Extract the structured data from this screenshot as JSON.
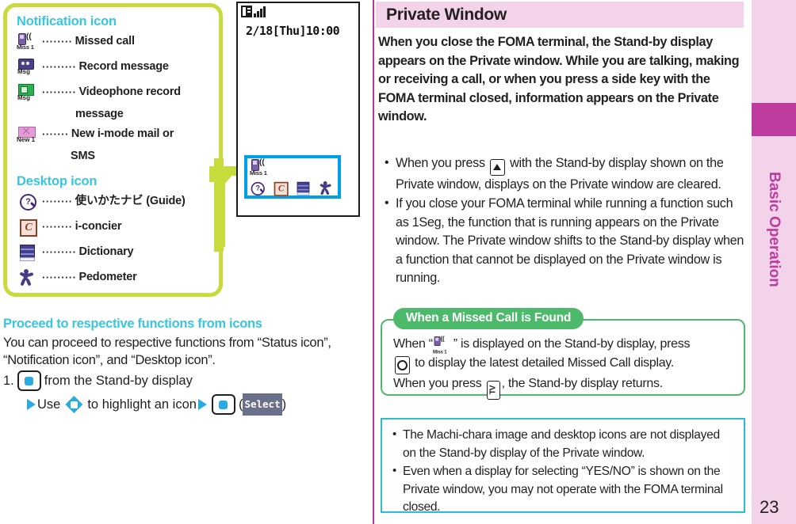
{
  "left": {
    "legend": {
      "notification_heading": "Notification icon",
      "desktop_heading": "Desktop icon",
      "notification_items": [
        {
          "icon": "missed-call-icon",
          "caption": "Miss 1",
          "dots": "········",
          "label": "Missed call",
          "label_cont": ""
        },
        {
          "icon": "record-message-icon",
          "caption": "Msg",
          "dots": "·········",
          "label": "Record message",
          "label_cont": ""
        },
        {
          "icon": "videophone-record-icon",
          "caption": "Msg",
          "dots": "·········",
          "label": "Videophone record",
          "label_cont": "message"
        },
        {
          "icon": "new-mail-icon",
          "caption": "New 1",
          "dots": "·······",
          "label": "New i-mode mail or",
          "label_cont": "SMS"
        }
      ],
      "desktop_items": [
        {
          "icon": "guide-icon",
          "dots": "········",
          "label": "使いかたナビ (Guide)"
        },
        {
          "icon": "i-concier-icon",
          "dots": "········",
          "label": "i-concier"
        },
        {
          "icon": "dictionary-icon",
          "dots": "·········",
          "label": "Dictionary"
        },
        {
          "icon": "pedometer-icon",
          "dots": "·········",
          "label": "Pedometer"
        }
      ]
    },
    "phone": {
      "datetime": "2/18[Thu]10:00",
      "missed_caption": "Miss 1",
      "dock_icons": [
        "guide-icon",
        "i-concier-icon",
        "dictionary-icon",
        "pedometer-icon"
      ]
    },
    "proceed": {
      "heading": "Proceed to respective functions from icons",
      "body": "You can proceed to respective functions from “Status icon”, “Notification icon”, and “Desktop icon”.",
      "step_number": "1.",
      "step_text": "from the Stand-by display",
      "step2_use": "Use",
      "step2_text": "to highlight an icon",
      "step2_open": "(",
      "step2_softkey": "Select",
      "step2_close": ")"
    }
  },
  "right": {
    "title": "Private Window",
    "intro": "When you close the FOMA terminal, the Stand-by display appears on the Private window. While you are talking, making or receiving a call, or when you press a side key with the FOMA terminal closed, information appears on the Private window.",
    "bullets": [
      {
        "pre": "When you press",
        "post": "with the Stand-by display shown on the Private window, displays on the Private window are cleared."
      },
      {
        "pre": "",
        "post": "If you close your FOMA terminal while running a function such as 1Seg, the function that is running appears on the Private window. The Private window shifts to the Stand-by display when a function that cannot be displayed on the Private window is running."
      }
    ],
    "callout": {
      "tab_label": "When a Missed Call is Found",
      "line1_pre": "When “",
      "line1_post": "” is displayed on the Stand-by display, press",
      "line2": "to display the latest detailed Missed Call display.",
      "line3_pre": "When you press",
      "line3_post": ", the Stand-by display returns.",
      "missed_caption": "Miss 1"
    },
    "notes": [
      "The Machi-chara image and desktop icons are not displayed on the Stand-by display of the Private window.",
      "Even when a display for selecting “YES/NO” is shown on the Private window, you may not operate with the FOMA terminal closed."
    ]
  },
  "tab": {
    "label": "Basic Operation",
    "page_number": "23"
  },
  "colors": {
    "legend_border": "#c7dc3c",
    "heading_cyan": "#38c6e0",
    "title_band": "#f2d3ea",
    "tab_pink": "#f2d3ea",
    "tab_magenta": "#be3c9e",
    "callout_green": "#4cb96b",
    "note_blue": "#2cbccd",
    "phone_highlight": "#00a0e9",
    "column_rule": "#b6359b",
    "key_blue": "#29abe2"
  }
}
